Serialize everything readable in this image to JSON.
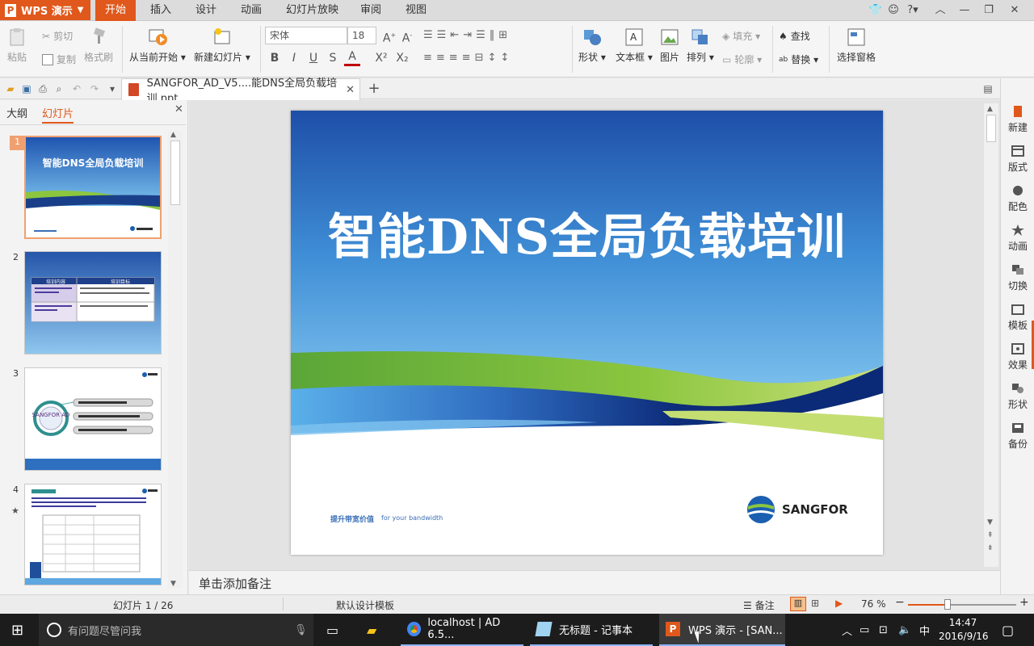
{
  "app": {
    "name": "WPS 演示"
  },
  "menu": [
    "开始",
    "插入",
    "设计",
    "动画",
    "幻灯片放映",
    "审阅",
    "视图"
  ],
  "ribbon": {
    "paste": "粘贴",
    "cut": "剪切",
    "copy": "复制",
    "format_painter": "格式刷",
    "from_current": "从当前开始",
    "new_slide": "新建幻灯片",
    "font_name": "宋体",
    "font_size": "18",
    "fill": "填充",
    "outline": "轮廓",
    "shape": "形状",
    "textbox": "文本框",
    "picture": "图片",
    "arrange": "排列",
    "find": "查找",
    "replace": "替换",
    "selection_pane": "选择窗格"
  },
  "document": {
    "tab_title": "SANGFOR_AD_V5....能DNS全局负载培训.ppt"
  },
  "panel": {
    "outline_tab": "大纲",
    "slides_tab": "幻灯片"
  },
  "thumbnails": [
    {
      "num": "1",
      "title": "智能DNS全局负载培训"
    },
    {
      "num": "2",
      "head1": "培训内容",
      "head2": "培训目标"
    },
    {
      "num": "3",
      "logo": "SANGFOR AD"
    },
    {
      "num": "4",
      "title": "智能DNS全局负载培训"
    }
  ],
  "slide": {
    "title": "智能DNS全局负载培训",
    "tagline_cn": "提升带宽价值",
    "tagline_en": "for your bandwidth",
    "brand": "SANGFOR"
  },
  "notes_placeholder": "单击添加备注",
  "right_panel": [
    "新建",
    "版式",
    "配色",
    "动画",
    "切换",
    "模板",
    "效果",
    "形状",
    "备份"
  ],
  "status": {
    "slide_counter": "幻灯片 1 / 26",
    "template": "默认设计模板",
    "notes": "备注",
    "zoom": "76 %"
  },
  "taskbar": {
    "search_placeholder": "有问题尽管问我",
    "apps": [
      {
        "label": "localhost | AD 6.5..."
      },
      {
        "label": "无标题 - 记事本"
      },
      {
        "label": "WPS 演示 - [SAN..."
      }
    ],
    "ime": "中",
    "time": "14:47",
    "date": "2016/9/16"
  },
  "colors": {
    "accent": "#e0581b",
    "slide_blue": "#2b6cc4",
    "slide_green": "#8cc63f",
    "brand_blue": "#1a3f8a"
  }
}
